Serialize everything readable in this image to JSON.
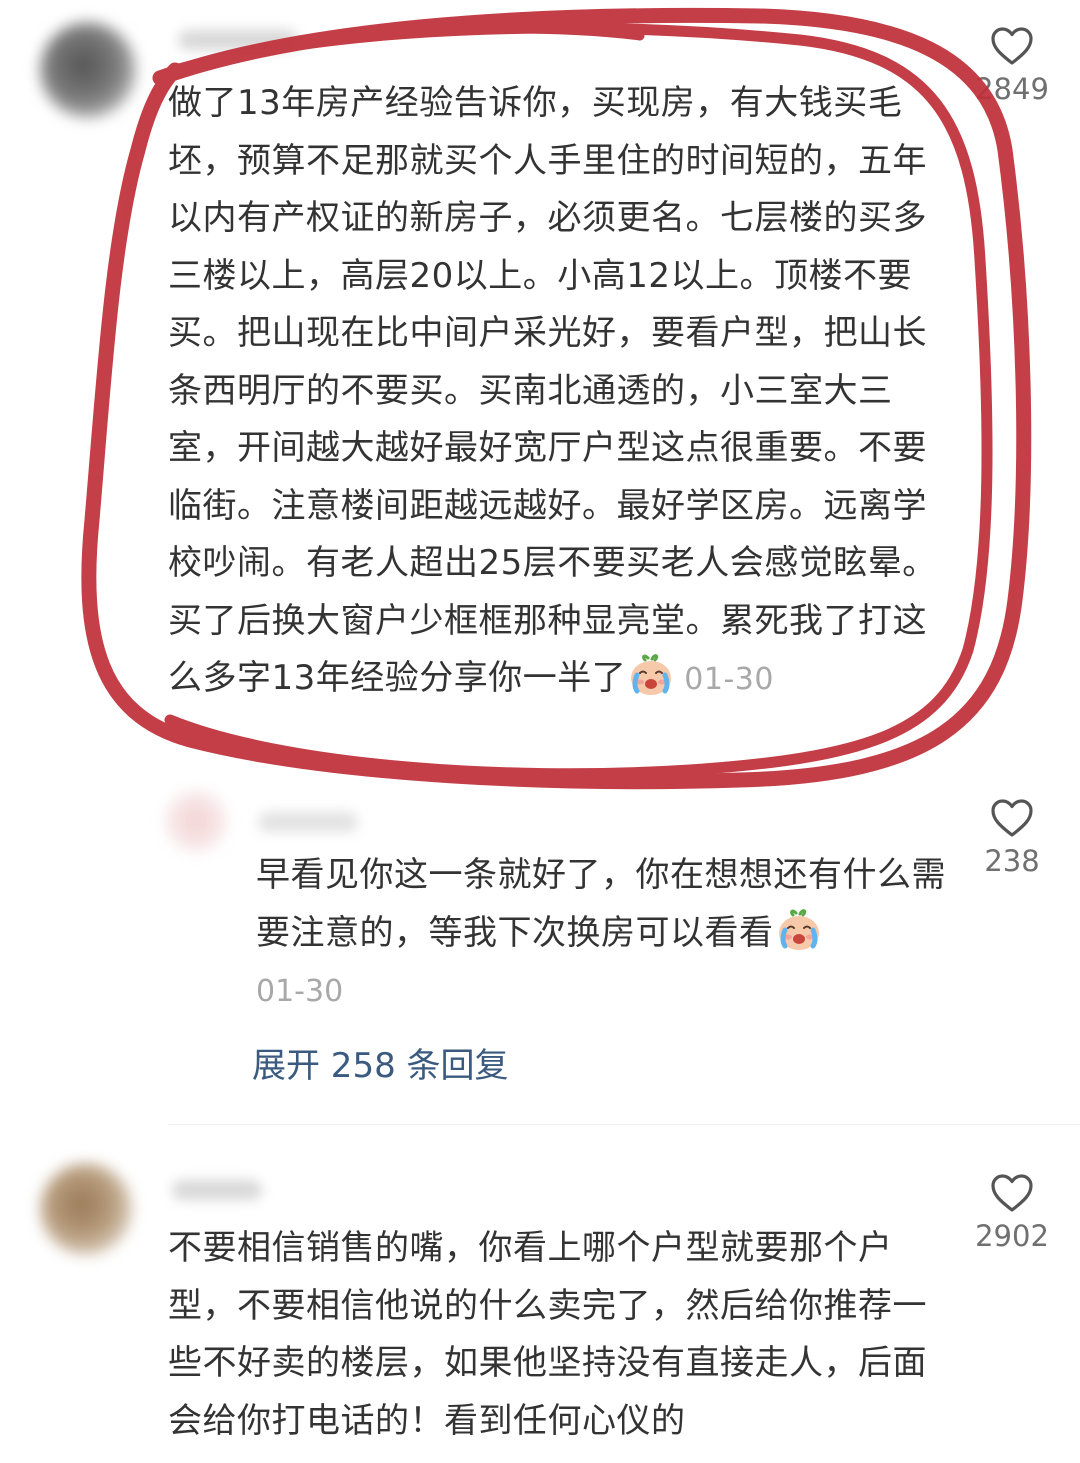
{
  "comments": [
    {
      "text": "做了13年房产经验告诉你，买现房，有大钱买毛坯，预算不足那就买个人手里住的时间短的，五年以内有产权证的新房子，必须更名。七层楼的买多三楼以上，高层20以上。小高12以上。顶楼不要买。把山现在比中间户采光好，要看户型，把山长条西明厅的不要买。买南北通透的，小三室大三室，开间越大越好最好宽厅户型这点很重要。不要临街。注意楼间距越远越好。最好学区房。远离学校吵闹。有老人超出25层不要买老人会感觉眩晕。买了后换大窗户少框框那种显亮堂。累死我了打这么多字13年经验分享你一半了",
      "emoji_icon": "crying-face-icon",
      "date": "01-30",
      "likes": "2849"
    },
    {
      "text": "早看见你这一条就好了，你在想想还有什么需要注意的，等我下次换房可以看看",
      "emoji_icon": "crying-face-icon",
      "date": "01-30",
      "likes": "238"
    },
    {
      "text": "不要相信销售的嘴，你看上哪个户型就要那个户型，不要相信他说的什么卖完了，然后给你推荐一些不好卖的楼层，如果他坚持没有直接走人，后面会给你打电话的！看到任何心仪的",
      "likes": "2902"
    }
  ],
  "expand_replies": "展开 258 条回复",
  "colors": {
    "text": "#333333",
    "meta": "#a8a8a8",
    "link": "#3a5a7f",
    "annotation_red": "#c0303a"
  }
}
